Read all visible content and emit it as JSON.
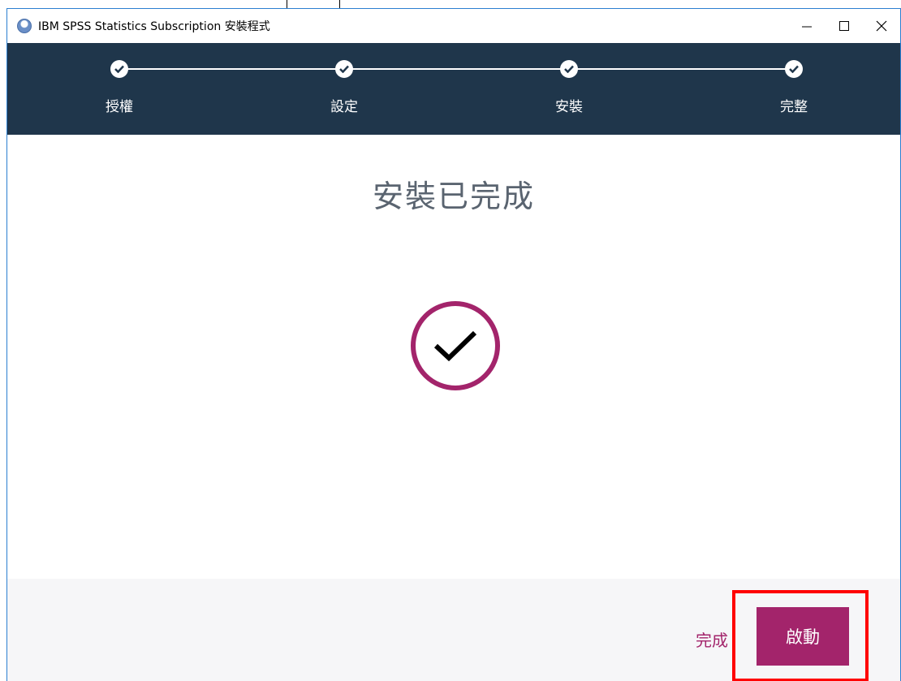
{
  "window": {
    "title": "IBM SPSS Statistics Subscription 安裝程式",
    "controls": [
      "minimize",
      "maximize",
      "close"
    ]
  },
  "steps": [
    {
      "label": "授權",
      "state": "completed"
    },
    {
      "label": "設定",
      "state": "completed"
    },
    {
      "label": "安裝",
      "state": "completed"
    },
    {
      "label": "完整",
      "state": "completed"
    }
  ],
  "main": {
    "heading": "安裝已完成",
    "status_icon": "check-circle-icon"
  },
  "footer": {
    "finish_label": "完成",
    "launch_label": "啟動"
  },
  "colors": {
    "stepper_bg": "#1f364b",
    "accent": "#a3246b",
    "footer_bg": "#f6f6f8",
    "highlight": "#ff0000"
  }
}
